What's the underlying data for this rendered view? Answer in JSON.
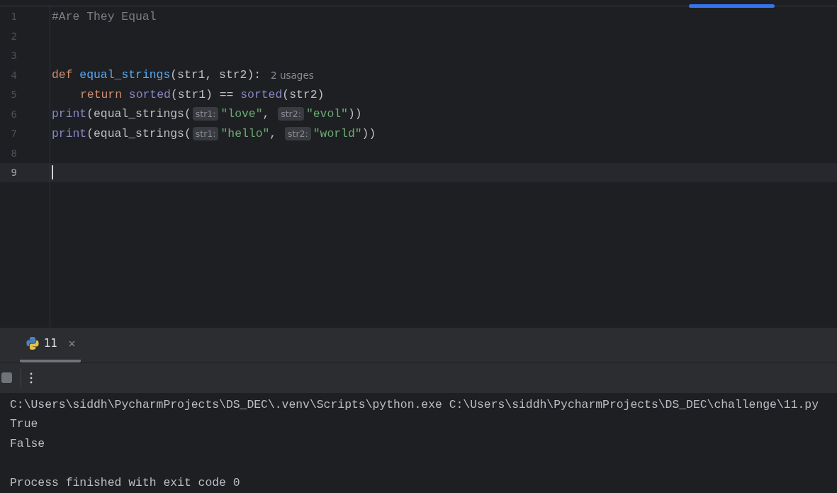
{
  "editor": {
    "lines": [
      {
        "number": "1",
        "current": false,
        "tokens": [
          {
            "kind": "comment",
            "text": "#Are They Equal"
          }
        ]
      },
      {
        "number": "2",
        "current": false
      },
      {
        "number": "3",
        "current": false
      },
      {
        "number": "4",
        "current": false,
        "tokens": [
          {
            "kind": "keyword",
            "text": "def "
          },
          {
            "kind": "function",
            "text": "equal_strings"
          },
          {
            "kind": "plain",
            "text": "(str1, str2):"
          },
          {
            "kind": "usages",
            "text": "2 usages"
          }
        ]
      },
      {
        "number": "5",
        "current": false,
        "indented": true,
        "tokens": [
          {
            "kind": "keyword",
            "text": "return "
          },
          {
            "kind": "builtin",
            "text": "sorted"
          },
          {
            "kind": "plain",
            "text": "(str1) == "
          },
          {
            "kind": "builtin",
            "text": "sorted"
          },
          {
            "kind": "plain",
            "text": "(str2)"
          }
        ]
      },
      {
        "number": "6",
        "current": false,
        "tokens": [
          {
            "kind": "builtin",
            "text": "print"
          },
          {
            "kind": "plain",
            "text": "(equal_strings("
          },
          {
            "kind": "hint",
            "text": "str1:"
          },
          {
            "kind": "string",
            "text": "\"love\""
          },
          {
            "kind": "plain",
            "text": ", "
          },
          {
            "kind": "hint",
            "text": "str2:"
          },
          {
            "kind": "string",
            "text": "\"evol\""
          },
          {
            "kind": "plain",
            "text": "))"
          }
        ]
      },
      {
        "number": "7",
        "current": false,
        "tokens": [
          {
            "kind": "builtin",
            "text": "print"
          },
          {
            "kind": "plain",
            "text": "(equal_strings("
          },
          {
            "kind": "hint",
            "text": "str1:"
          },
          {
            "kind": "string",
            "text": "\"hello\""
          },
          {
            "kind": "plain",
            "text": ", "
          },
          {
            "kind": "hint",
            "text": "str2:"
          },
          {
            "kind": "string",
            "text": "\"world\""
          },
          {
            "kind": "plain",
            "text": "))"
          }
        ]
      },
      {
        "number": "8",
        "current": false
      },
      {
        "number": "9",
        "current": true
      }
    ]
  },
  "run_panel": {
    "tabs": [
      {
        "label": "11",
        "selected": true
      }
    ],
    "console": {
      "output": [
        "C:\\Users\\siddh\\PycharmProjects\\DS_DEC\\.venv\\Scripts\\python.exe C:\\Users\\siddh\\PycharmProjects\\DS_DEC\\challenge\\11.py",
        "True",
        "False"
      ],
      "exit_message": "Process finished with exit code 0"
    }
  }
}
